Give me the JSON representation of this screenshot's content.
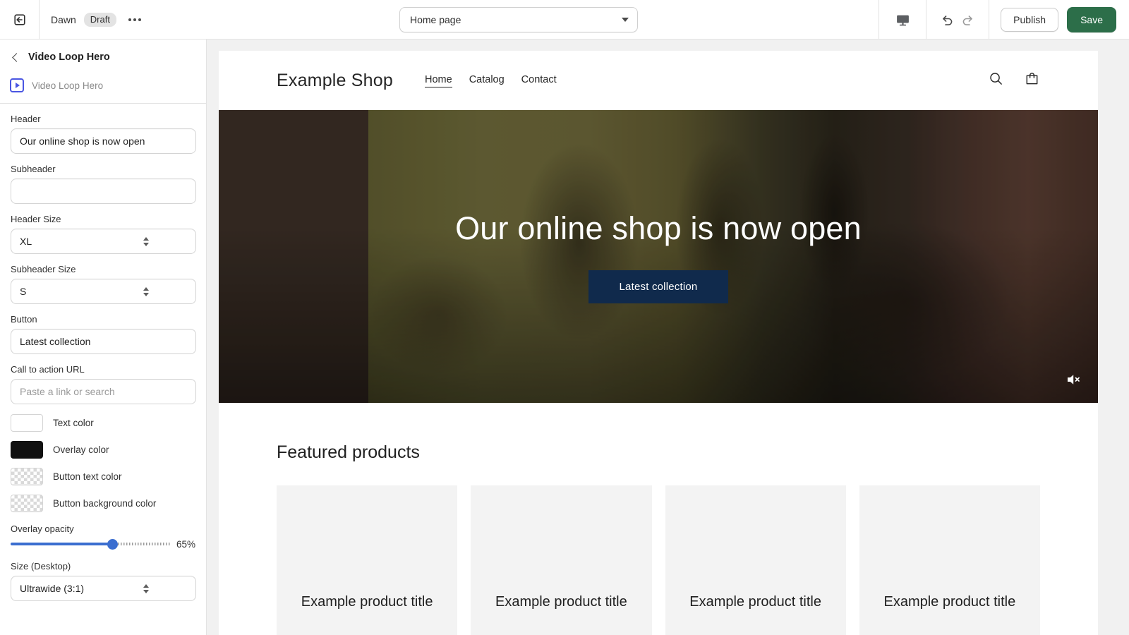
{
  "topbar": {
    "exit_icon": "exit-icon",
    "theme_name": "Dawn",
    "status_badge": "Draft",
    "more_icon": "ellipsis-icon",
    "page_selector": {
      "value": "Home page",
      "caret_icon": "chevron-down-icon"
    },
    "device_icon": "desktop-icon",
    "undo_icon": "undo-icon",
    "redo_icon": "redo-icon",
    "publish_label": "Publish",
    "save_label": "Save",
    "save_color": "#2c6e49"
  },
  "sidebar": {
    "back_icon": "chevron-left-icon",
    "title": "Video Loop Hero",
    "block_icon": "video-block-icon",
    "block_label": "Video Loop Hero",
    "fields": {
      "header": {
        "label": "Header",
        "value": "Our online shop is now open"
      },
      "subheader": {
        "label": "Subheader",
        "value": ""
      },
      "header_size": {
        "label": "Header Size",
        "value": "XL"
      },
      "subheader_size": {
        "label": "Subheader Size",
        "value": "S"
      },
      "button": {
        "label": "Button",
        "value": "Latest collection"
      },
      "cta_url": {
        "label": "Call to action URL",
        "value": "",
        "placeholder": "Paste a link or search"
      },
      "size_desktop": {
        "label": "Size (Desktop)",
        "value": "Ultrawide (3:1)"
      }
    },
    "colors": [
      {
        "label": "Text color",
        "swatch": "solid",
        "value": "#ffffff"
      },
      {
        "label": "Overlay color",
        "swatch": "solid",
        "value": "#111111"
      },
      {
        "label": "Button text color",
        "swatch": "transparent",
        "value": ""
      },
      {
        "label": "Button background color",
        "swatch": "transparent",
        "value": ""
      }
    ],
    "overlay_opacity": {
      "label": "Overlay opacity",
      "value": "65%",
      "percent": 65,
      "accent": "#3b6ed0"
    }
  },
  "preview": {
    "store": {
      "logo": "Example Shop",
      "nav": [
        {
          "label": "Home",
          "active": true
        },
        {
          "label": "Catalog",
          "active": false
        },
        {
          "label": "Contact",
          "active": false
        }
      ],
      "search_icon": "search-icon",
      "cart_icon": "cart-icon"
    },
    "hero": {
      "title": "Our online shop is now open",
      "button_label": "Latest collection",
      "button_color": "#102a4c",
      "mute_icon": "mute-icon"
    },
    "featured": {
      "title": "Featured products",
      "products": [
        {
          "title": "Example product title"
        },
        {
          "title": "Example product title"
        },
        {
          "title": "Example product title"
        },
        {
          "title": "Example product title"
        }
      ]
    }
  }
}
